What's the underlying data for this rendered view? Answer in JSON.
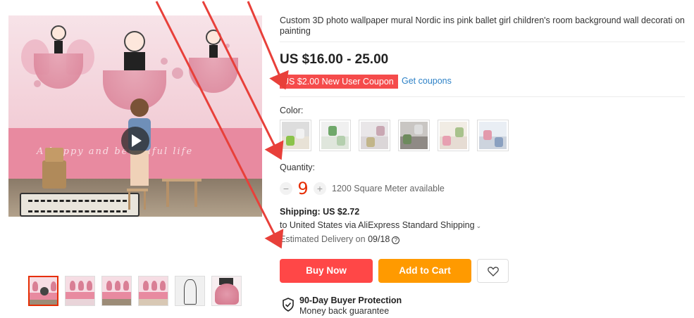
{
  "product": {
    "title": "Custom 3D photo wallpaper mural Nordic ins pink ballet girl children's room background wall decorati on painting",
    "price": "US $16.00 - 25.00",
    "coupon": "US $2.00 New User Coupon",
    "get_coupons": "Get coupons",
    "image_script_text": "A happy and beautiful life",
    "thumbnails_count": 6
  },
  "color": {
    "label": "Color:",
    "swatch_count": 6
  },
  "quantity": {
    "label": "Quantity:",
    "minus": "−",
    "plus": "+",
    "value": "9",
    "available": "1200 Square Meter available"
  },
  "shipping": {
    "heading": "Shipping: US $2.72",
    "method": "to United States via AliExpress Standard Shipping",
    "delivery_prefix": "Estimated Delivery on",
    "delivery_date": "09/18",
    "help_icon": "?"
  },
  "actions": {
    "buy_now": "Buy Now",
    "add_to_cart": "Add to Cart",
    "wishlist_icon": "heart-icon"
  },
  "protection": {
    "title": "90-Day Buyer Protection",
    "subtitle": "Money back guarantee",
    "icon": "shield-check-icon"
  },
  "colors": {
    "buy": "#ff4747",
    "cart": "#ff9a00",
    "coupon": "#f54b4b",
    "link": "#2e82c7",
    "annotation_arrow": "#e8403a",
    "qty_value": "#e62e04"
  }
}
